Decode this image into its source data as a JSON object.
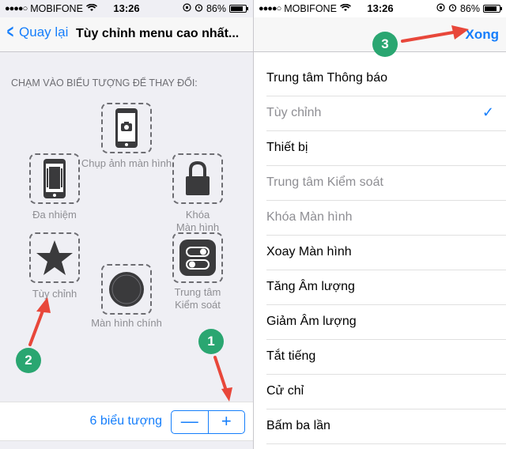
{
  "status": {
    "carrier": "MOBIFONE",
    "time": "13:26",
    "battery": "86%",
    "signal_dots": "●●●●○"
  },
  "left": {
    "back_label": "Quay lại",
    "title": "Tùy chỉnh menu cao nhất...",
    "section_header": "CHẠM VÀO BIỂU TƯỢNG ĐỂ THAY ĐỔI:",
    "icons": {
      "camera": "Chụp ảnh màn hình",
      "multitask": "Đa nhiệm",
      "lock": "Khóa\nMàn hình",
      "custom": "Tùy chỉnh",
      "control": "Trung tâm\nKiểm soát",
      "home": "Màn hình chính"
    },
    "count_label": "6 biểu tượng",
    "minus": "—",
    "plus": "+"
  },
  "right": {
    "done_label": "Xong",
    "items": [
      {
        "label": "Trung tâm Thông báo",
        "disabled": false
      },
      {
        "label": "Tùy chỉnh",
        "disabled": true,
        "checked": true
      },
      {
        "label": "Thiết bị",
        "disabled": false
      },
      {
        "label": "Trung tâm Kiểm soát",
        "disabled": true
      },
      {
        "label": "Khóa Màn hình",
        "disabled": true
      },
      {
        "label": "Xoay Màn hình",
        "disabled": false
      },
      {
        "label": "Tăng Âm lượng",
        "disabled": false
      },
      {
        "label": "Giảm Âm lượng",
        "disabled": false
      },
      {
        "label": "Tắt tiếng",
        "disabled": false
      },
      {
        "label": "Cử chỉ",
        "disabled": false
      },
      {
        "label": "Bấm ba lần",
        "disabled": false
      }
    ],
    "checkmark": "✓"
  },
  "badges": {
    "one": "1",
    "two": "2",
    "three": "3"
  },
  "colors": {
    "accent": "#157efb",
    "badge": "#2aa671",
    "arrow": "#e8473a"
  }
}
